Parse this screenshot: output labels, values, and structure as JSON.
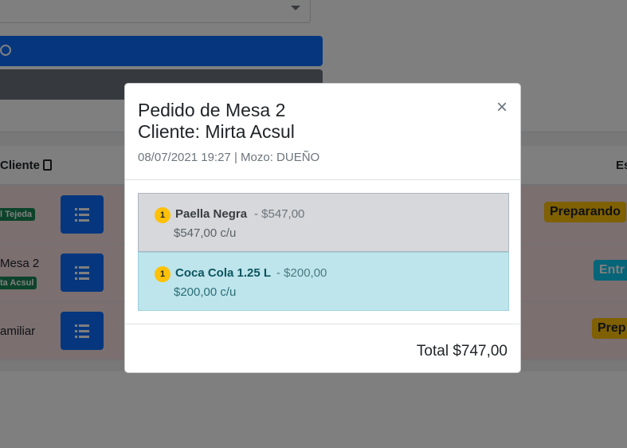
{
  "background": {
    "table": {
      "header_cliente": "Cliente",
      "header_estado": "Es",
      "rows": [
        {
          "cliente_badge": "l Tejeda",
          "estado": "Preparando"
        },
        {
          "cliente_text": "Mesa 2",
          "cliente_badge": "ta Acsul",
          "estado": "Entr"
        },
        {
          "cliente_text": "amiliar",
          "estado": "Prep"
        }
      ]
    }
  },
  "modal": {
    "title_line1": "Pedido de Mesa 2",
    "title_line2": "Cliente: Mirta Acsul",
    "subtitle": "08/07/2021 19:27 | Mozo: DUEÑO",
    "close_label": "×",
    "items": [
      {
        "qty": "1",
        "name": "Paella Negra",
        "price": "- $547,00",
        "unit": "$547,00 c/u"
      },
      {
        "qty": "1",
        "name": "Coca Cola 1.25 L",
        "price": "- $200,00",
        "unit": "$200,00 c/u"
      }
    ],
    "total": "Total $747,00"
  },
  "colors": {
    "primary": "#0d6efd",
    "warning": "#ffc107",
    "item_secondary": "#d6d8db",
    "item_info": "#bee5eb"
  }
}
